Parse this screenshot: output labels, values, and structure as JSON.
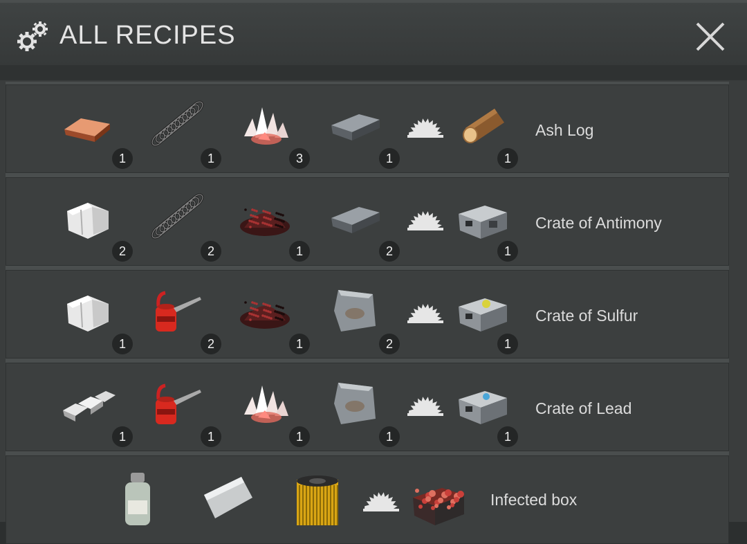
{
  "window": {
    "title": "ALL RECIPES"
  },
  "recipes": [
    {
      "result_name": "Ash Log",
      "ingredients": [
        {
          "icon": "copper-ingot-icon",
          "qty": "1"
        },
        {
          "icon": "spring-icon",
          "qty": "1"
        },
        {
          "icon": "crystals-icon",
          "qty": "3"
        },
        {
          "icon": "iron-ingot-icon",
          "qty": "1"
        }
      ],
      "result": {
        "icon": "log-icon",
        "qty": "1"
      }
    },
    {
      "result_name": "Crate of Antimony",
      "ingredients": [
        {
          "icon": "quartz-icon",
          "qty": "2"
        },
        {
          "icon": "spring-icon",
          "qty": "2"
        },
        {
          "icon": "red-ore-pile-icon",
          "qty": "1"
        },
        {
          "icon": "iron-ingot-icon",
          "qty": "2"
        }
      ],
      "result": {
        "icon": "metal-crate-icon",
        "qty": "1"
      }
    },
    {
      "result_name": "Crate of Sulfur",
      "ingredients": [
        {
          "icon": "quartz-icon",
          "qty": "1"
        },
        {
          "icon": "oil-can-icon",
          "qty": "2"
        },
        {
          "icon": "red-ore-pile-icon",
          "qty": "1"
        },
        {
          "icon": "steel-plate-icon",
          "qty": "2"
        }
      ],
      "result": {
        "icon": "metal-crate-yellow-icon",
        "qty": "1"
      }
    },
    {
      "result_name": "Crate of Lead",
      "ingredients": [
        {
          "icon": "silver-bars-icon",
          "qty": "1"
        },
        {
          "icon": "oil-can-icon",
          "qty": "1"
        },
        {
          "icon": "crystals-icon",
          "qty": "1"
        },
        {
          "icon": "steel-plate-icon",
          "qty": "1"
        }
      ],
      "result": {
        "icon": "metal-crate-blue-icon",
        "qty": "1"
      }
    },
    {
      "result_name": "Infected box",
      "ingredients": [
        {
          "icon": "bottle-icon",
          "qty": ""
        },
        {
          "icon": "metal-pipe-icon",
          "qty": ""
        },
        {
          "icon": "oil-filter-icon",
          "qty": ""
        }
      ],
      "result": {
        "icon": "infected-box-icon",
        "qty": ""
      }
    }
  ],
  "icons": {
    "gear": "gear-icon",
    "close": "close-icon",
    "saw": "saw-blade-icon"
  },
  "colors": {
    "badge": "#242626",
    "row": "#3c3f3f",
    "title_text": "#e4e4e4"
  }
}
